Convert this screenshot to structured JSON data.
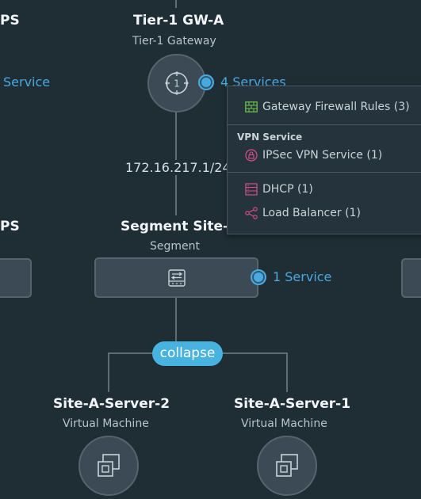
{
  "left_partial": {
    "top_title": "PS",
    "service_link": "Service",
    "mid_title": "PS"
  },
  "tier1": {
    "title": "Tier-1 GW-A",
    "subtitle": "Tier-1 Gateway",
    "icon": "router-icon",
    "services_link": "4 Services",
    "ip": "172.16.217.1/24"
  },
  "segment": {
    "title": "Segment Site-A",
    "subtitle": "Segment",
    "icon": "segment-switch-icon",
    "services_link": "1 Service"
  },
  "collapse_label": "collapse",
  "vms": [
    {
      "title": "Site-A-Server-2",
      "subtitle": "Virtual Machine",
      "icon": "vm-icon"
    },
    {
      "title": "Site-A-Server-1",
      "subtitle": "Virtual Machine",
      "icon": "vm-icon"
    }
  ],
  "services_popup": {
    "firewall": "Gateway Firewall Rules (3)",
    "vpn_section": "VPN Service",
    "ipsec": "IPSec VPN Service (1)",
    "dhcp": "DHCP (1)",
    "lb": "Load Balancer (1)"
  },
  "colors": {
    "background": "#1f2d35",
    "accent": "#4aa9de",
    "firewall_icon": "#6abf4b",
    "vpn_icon": "#d94f8a",
    "dhcp_icon": "#d94f8a",
    "lb_icon": "#d94f8a"
  }
}
